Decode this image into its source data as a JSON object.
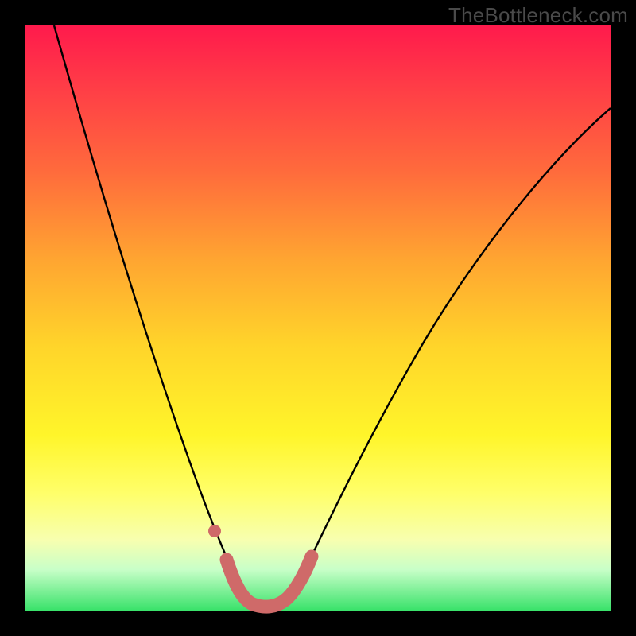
{
  "watermark": "TheBottleneck.com",
  "colors": {
    "frame": "#000000",
    "curve_line": "#000000",
    "marker_stroke": "#cf6a69",
    "marker_fill": "#cf6a69",
    "gradient_top": "#ff1a4c",
    "gradient_bottom": "#39e26a"
  },
  "chart_data": {
    "type": "line",
    "title": "",
    "xlabel": "",
    "ylabel": "",
    "xlim": [
      0,
      100
    ],
    "ylim": [
      0,
      100
    ],
    "grid": false,
    "legend": false,
    "series": [
      {
        "name": "curve",
        "x": [
          5,
          8,
          12,
          16,
          20,
          24,
          28,
          30,
          32,
          33.5,
          35,
          36.5,
          38,
          40,
          43,
          47,
          52,
          58,
          66,
          76,
          88,
          100
        ],
        "y": [
          100,
          85,
          68,
          54,
          42,
          31,
          21,
          16,
          11,
          8,
          5.5,
          4,
          3.2,
          3,
          3.5,
          5,
          8,
          13,
          21,
          33,
          48,
          63
        ]
      },
      {
        "name": "markers-left",
        "x": [
          30.5,
          31.8
        ],
        "y": [
          14,
          10
        ]
      },
      {
        "name": "markers-bottom",
        "x": [
          34,
          36,
          38,
          40,
          42,
          44
        ],
        "y": [
          4.2,
          3.3,
          3.0,
          3.0,
          3.2,
          3.6
        ]
      },
      {
        "name": "markers-right",
        "x": [
          45.5,
          46.8
        ],
        "y": [
          4.5,
          5.5
        ]
      }
    ]
  }
}
